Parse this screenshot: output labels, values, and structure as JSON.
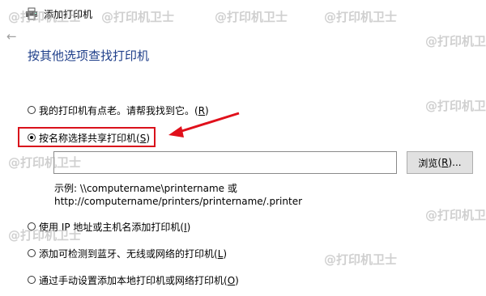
{
  "window": {
    "title": "添加打印机",
    "back_glyph": "←"
  },
  "page": {
    "heading": "按其他选项查找打印机"
  },
  "options": [
    {
      "text": "我的打印机有点老。请帮我找到它。",
      "key": "R",
      "checked": false
    },
    {
      "text": "按名称选择共享打印机",
      "key": "S",
      "checked": true
    },
    {
      "text": "使用 IP 地址或主机名添加打印机",
      "key": "I",
      "checked": false
    },
    {
      "text": "添加可检测到蓝牙、无线或网络的打印机",
      "key": "L",
      "checked": false
    },
    {
      "text": "通过手动设置添加本地打印机或网络打印机",
      "key": "O",
      "checked": false
    }
  ],
  "shared": {
    "input_value": "",
    "browse_text": "浏览",
    "browse_key": "R",
    "browse_suffix": "...",
    "example_line1": "示例: \\\\computername\\printername 或",
    "example_line2": "http://computername/printers/printername/.printer"
  },
  "watermark": "@打印机卫士",
  "colors": {
    "heading": "#1f3f8a",
    "highlight": "#d9111b",
    "arrow": "#e0101b"
  }
}
